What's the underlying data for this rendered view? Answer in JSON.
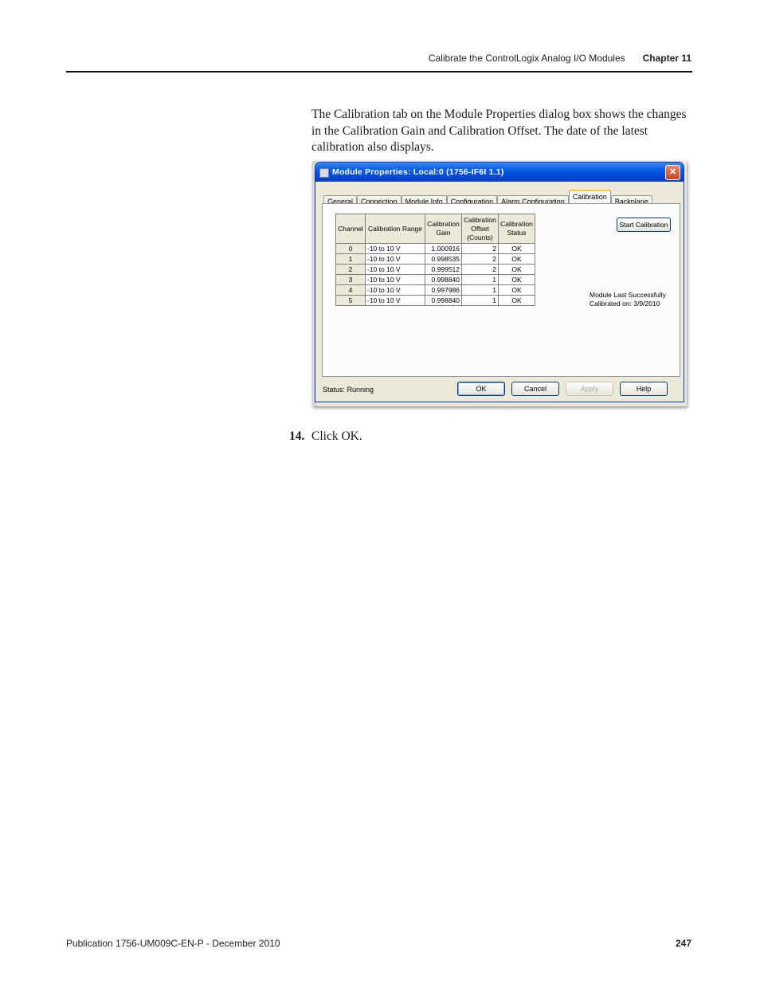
{
  "header": {
    "section_title": "Calibrate the ControlLogix Analog I/O Modules",
    "chapter": "Chapter 11"
  },
  "intro_text": "The Calibration tab on the Module Properties dialog box shows the changes in the Calibration Gain and Calibration Offset. The date of the latest calibration also displays.",
  "dialog": {
    "title": "Module Properties: Local:0 (1756-IF6I 1.1)",
    "close_glyph": "✕",
    "tabs": [
      "General",
      "Connection",
      "Module Info",
      "Configuration",
      "Alarm Configuration",
      "Calibration",
      "Backplane"
    ],
    "active_tab": "Calibration",
    "table": {
      "headers": [
        "Channel",
        "Calibration Range",
        "Calibration Gain",
        "Calibration Offset (Counts)",
        "Calibration Status"
      ],
      "rows": [
        {
          "channel": "0",
          "range": "-10 to 10 V",
          "gain": "1.000916",
          "offset": "2",
          "status": "OK"
        },
        {
          "channel": "1",
          "range": "-10 to 10 V",
          "gain": "0.998535",
          "offset": "2",
          "status": "OK"
        },
        {
          "channel": "2",
          "range": "-10 to 10 V",
          "gain": "0.999512",
          "offset": "2",
          "status": "OK"
        },
        {
          "channel": "3",
          "range": "-10 to 10 V",
          "gain": "0.998840",
          "offset": "1",
          "status": "OK"
        },
        {
          "channel": "4",
          "range": "-10 to 10 V",
          "gain": "0.997986",
          "offset": "1",
          "status": "OK"
        },
        {
          "channel": "5",
          "range": "-10 to 10 V",
          "gain": "0.998840",
          "offset": "1",
          "status": "OK"
        }
      ]
    },
    "start_calibration_label": "Start Calibration",
    "last_calibration_line1": "Module Last Successfully",
    "last_calibration_line2": "Calibrated on:  3/9/2010",
    "status_text": "Status:  Running",
    "buttons": {
      "ok": "OK",
      "cancel": "Cancel",
      "apply": "Apply",
      "help": "Help"
    }
  },
  "step": {
    "number": "14.",
    "text": "Click OK."
  },
  "footer": {
    "publication": "Publication 1756-UM009C-EN-P - December 2010",
    "page_number": "247"
  }
}
